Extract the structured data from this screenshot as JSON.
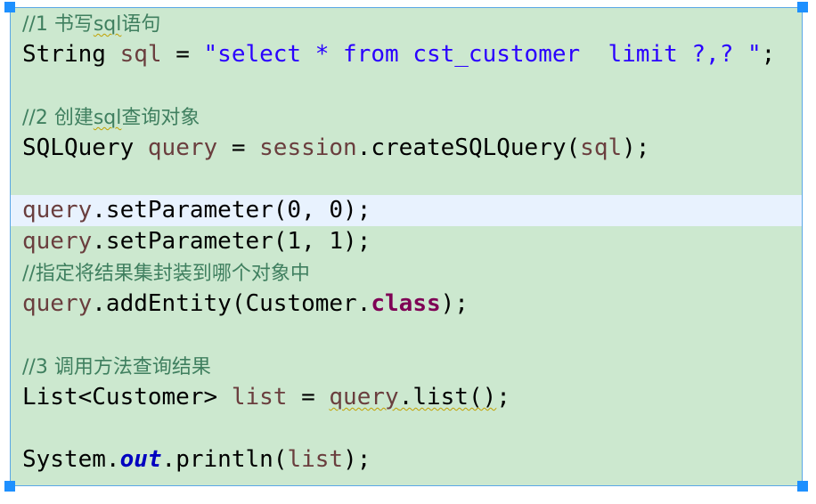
{
  "editor": {
    "background": "#cce8cf",
    "highlight": "#e8f2fe",
    "selection_handle_color": "#1e90ff",
    "lines": {
      "l1_comment_pre": "//1 书写",
      "l1_comment_word": "sql",
      "l1_comment_post": "语句",
      "l2_type": "String ",
      "l2_var": "sql",
      "l2_eq": " = ",
      "l2_str": "\"select * from cst_customer  limit ?,? \"",
      "l2_end": ";",
      "l4_comment_pre": "//2 创建",
      "l4_comment_word": "sql",
      "l4_comment_post": "查询对象",
      "l5_type": "SQLQuery ",
      "l5_var": "query",
      "l5_eq": " = ",
      "l5_session": "session",
      "l5_call": ".createSQLQuery(",
      "l5_arg": "sql",
      "l5_end": ");",
      "l7_var": "query",
      "l7_call": ".setParameter(0, 0);",
      "l8_var": "query",
      "l8_call": ".setParameter(1, 1);",
      "l9_comment": "//指定将结果集封装到哪个对象中",
      "l10_var": "query",
      "l10_call": ".addEntity(Customer.",
      "l10_kw": "class",
      "l10_end": ");",
      "l12_comment": "//3 调用方法查询结果",
      "l13_type": "List<Customer> ",
      "l13_var": "list",
      "l13_eq": " = ",
      "l13_query": "query",
      "l13_call": ".list()",
      "l13_end": ";",
      "l15_sys": "System.",
      "l15_out": "out",
      "l15_call": ".println(",
      "l15_arg": "list",
      "l15_end": ");"
    }
  }
}
